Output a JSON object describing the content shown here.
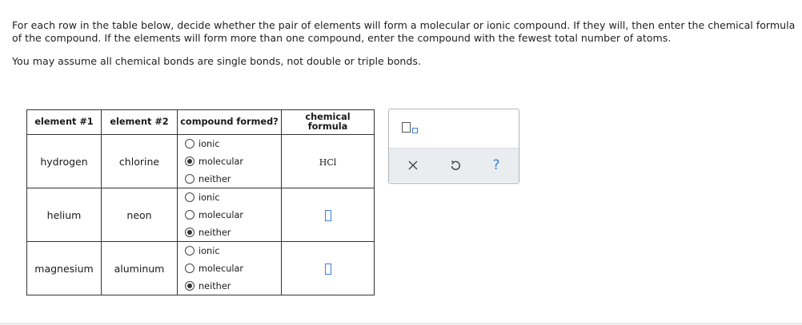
{
  "instructions": {
    "line1": "For each row in the table below, decide whether the pair of elements will form a molecular or ionic compound. If they will, then enter the chemical formula of the compound. If the elements will form more than one compound, enter the compound with the fewest total number of atoms.",
    "line2": "You may assume all chemical bonds are single bonds, not double or triple bonds."
  },
  "table": {
    "headers": {
      "element1": "element #1",
      "element2": "element #2",
      "compound": "compound formed?",
      "formula": "chemical formula"
    },
    "option_labels": [
      "ionic",
      "molecular",
      "neither"
    ],
    "rows": [
      {
        "element1": "hydrogen",
        "element2": "chlorine",
        "selected": "molecular",
        "formula": "HCl"
      },
      {
        "element1": "helium",
        "element2": "neon",
        "selected": "neither",
        "formula": ""
      },
      {
        "element1": "magnesium",
        "element2": "aluminum",
        "selected": "neither",
        "formula": ""
      }
    ]
  },
  "toolpanel": {
    "icons": [
      "superscript-subscript-icon",
      "clear-icon",
      "undo-icon",
      "help-icon"
    ],
    "help_glyph": "?"
  },
  "colors": {
    "accent": "#3b7fd8",
    "toolbar_bg": "#e9edf0",
    "border": "#333333"
  }
}
